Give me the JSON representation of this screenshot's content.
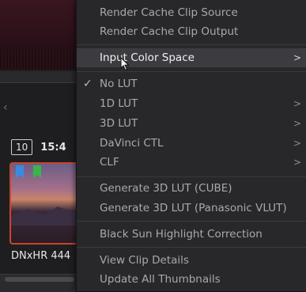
{
  "background": {
    "clip_number": "10",
    "clip_time": "15:4",
    "clip_name": "DNxHR 444"
  },
  "menu": {
    "items": [
      {
        "label": "Render Cache Clip Source",
        "has_submenu": false
      },
      {
        "label": "Render Cache Clip Output",
        "has_submenu": false
      },
      {
        "label": "Input Color Space",
        "has_submenu": true,
        "active": true
      },
      {
        "label": "No LUT",
        "checked": true,
        "has_submenu": false
      },
      {
        "label": "1D LUT",
        "has_submenu": true
      },
      {
        "label": "3D LUT",
        "has_submenu": true
      },
      {
        "label": "DaVinci CTL",
        "has_submenu": true
      },
      {
        "label": "CLF",
        "has_submenu": true
      },
      {
        "label": "Generate 3D LUT (CUBE)",
        "has_submenu": false
      },
      {
        "label": "Generate 3D LUT (Panasonic VLUT)",
        "has_submenu": false
      },
      {
        "label": "Black Sun Highlight Correction",
        "has_submenu": false
      },
      {
        "label": "View Clip Details",
        "has_submenu": false
      },
      {
        "label": "Update All Thumbnails",
        "has_submenu": false
      }
    ],
    "submenu_glyph": ">",
    "check_glyph": "✓"
  },
  "colors": {
    "menu_bg": "#28282b",
    "highlight_bg": "#3b3b40",
    "text": "#a9a9ad",
    "selected_clip_border": "#c9452e"
  }
}
